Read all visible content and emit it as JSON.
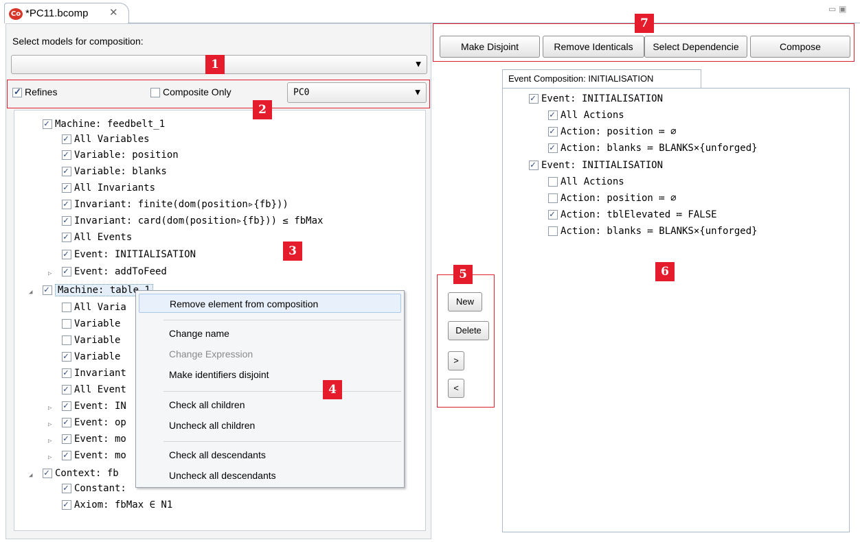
{
  "editor": {
    "tab_title": "*PC11.bcomp",
    "app_icon_text": "Co",
    "close_glyph": "✕",
    "win_controls": "▭ ▣"
  },
  "left": {
    "select_label": "Select models for composition:",
    "models_combo_value": "",
    "refines_label": "Refines",
    "refines_checked": true,
    "composite_only_label": "Composite Only",
    "composite_only_checked": false,
    "pc_combo_value": "PC0"
  },
  "tree": {
    "nodes": [
      {
        "label": "Machine: feedbelt_1",
        "checked": true
      },
      {
        "label": "All Variables",
        "checked": true
      },
      {
        "label": "Variable: position",
        "checked": true
      },
      {
        "label": "Variable: blanks",
        "checked": true
      },
      {
        "label": "All Invariants",
        "checked": true
      },
      {
        "label": "Invariant: finite(dom(position▹{fb}))",
        "checked": true
      },
      {
        "label": "Invariant: card(dom(position▹{fb})) ≤ fbMax",
        "checked": true
      },
      {
        "label": "All Events",
        "checked": true
      },
      {
        "label": "Event: INITIALISATION",
        "checked": true
      },
      {
        "label": "Event: addToFeed",
        "checked": true
      },
      {
        "label": "Machine: table_1",
        "checked": true
      },
      {
        "label": "All Varia",
        "checked": false
      },
      {
        "label": "Variable",
        "checked": false
      },
      {
        "label": "Variable",
        "checked": false
      },
      {
        "label": "Variable",
        "checked": true
      },
      {
        "label": "Invariant",
        "checked": true
      },
      {
        "label": "All Event",
        "checked": true
      },
      {
        "label": "Event: IN",
        "checked": true
      },
      {
        "label": "Event: op",
        "checked": true
      },
      {
        "label": "Event: mo",
        "checked": true
      },
      {
        "label": "Event: mo",
        "checked": true
      },
      {
        "label": "Context: fb",
        "checked": true
      },
      {
        "label": "Constant:",
        "checked": true
      },
      {
        "label": "Axiom: fbMax ∈ N1",
        "checked": true
      }
    ]
  },
  "context_menu": {
    "items": [
      "Remove element from composition",
      "Change name",
      "Change Expression",
      "Make identifiers disjoint",
      "Check all children",
      "Uncheck all children",
      "Check all descendants",
      "Uncheck all descendants"
    ]
  },
  "middle": {
    "new_label": "New",
    "delete_label": "Delete",
    "right_label": ">",
    "left_label": "<"
  },
  "toolbar": {
    "make_disjoint": "Make Disjoint",
    "remove_identicals": "Remove Identicals",
    "select_dependencies": "Select Dependencie",
    "compose": "Compose"
  },
  "right": {
    "tab_label": "Event Composition: INITIALISATION",
    "nodes": [
      {
        "label": "Event: INITIALISATION",
        "checked": true
      },
      {
        "label": "All Actions",
        "checked": true
      },
      {
        "label": "Action: position ≔ ∅",
        "checked": true
      },
      {
        "label": "Action: blanks ≔ BLANKS×{unforged}",
        "checked": true
      },
      {
        "label": "Event: INITIALISATION",
        "checked": true
      },
      {
        "label": "All Actions",
        "checked": false
      },
      {
        "label": "Action: position ≔ ∅",
        "checked": false
      },
      {
        "label": "Action: tblElevated ≔ FALSE",
        "checked": true
      },
      {
        "label": "Action: blanks ≔ BLANKS×{unforged}",
        "checked": false
      }
    ]
  },
  "annotations": [
    "1",
    "2",
    "3",
    "4",
    "5",
    "6",
    "7"
  ],
  "colors": {
    "annotation_red": "#e41c2b",
    "checkbox_tick": "#2d4a82",
    "app_icon": "#d9362b"
  }
}
